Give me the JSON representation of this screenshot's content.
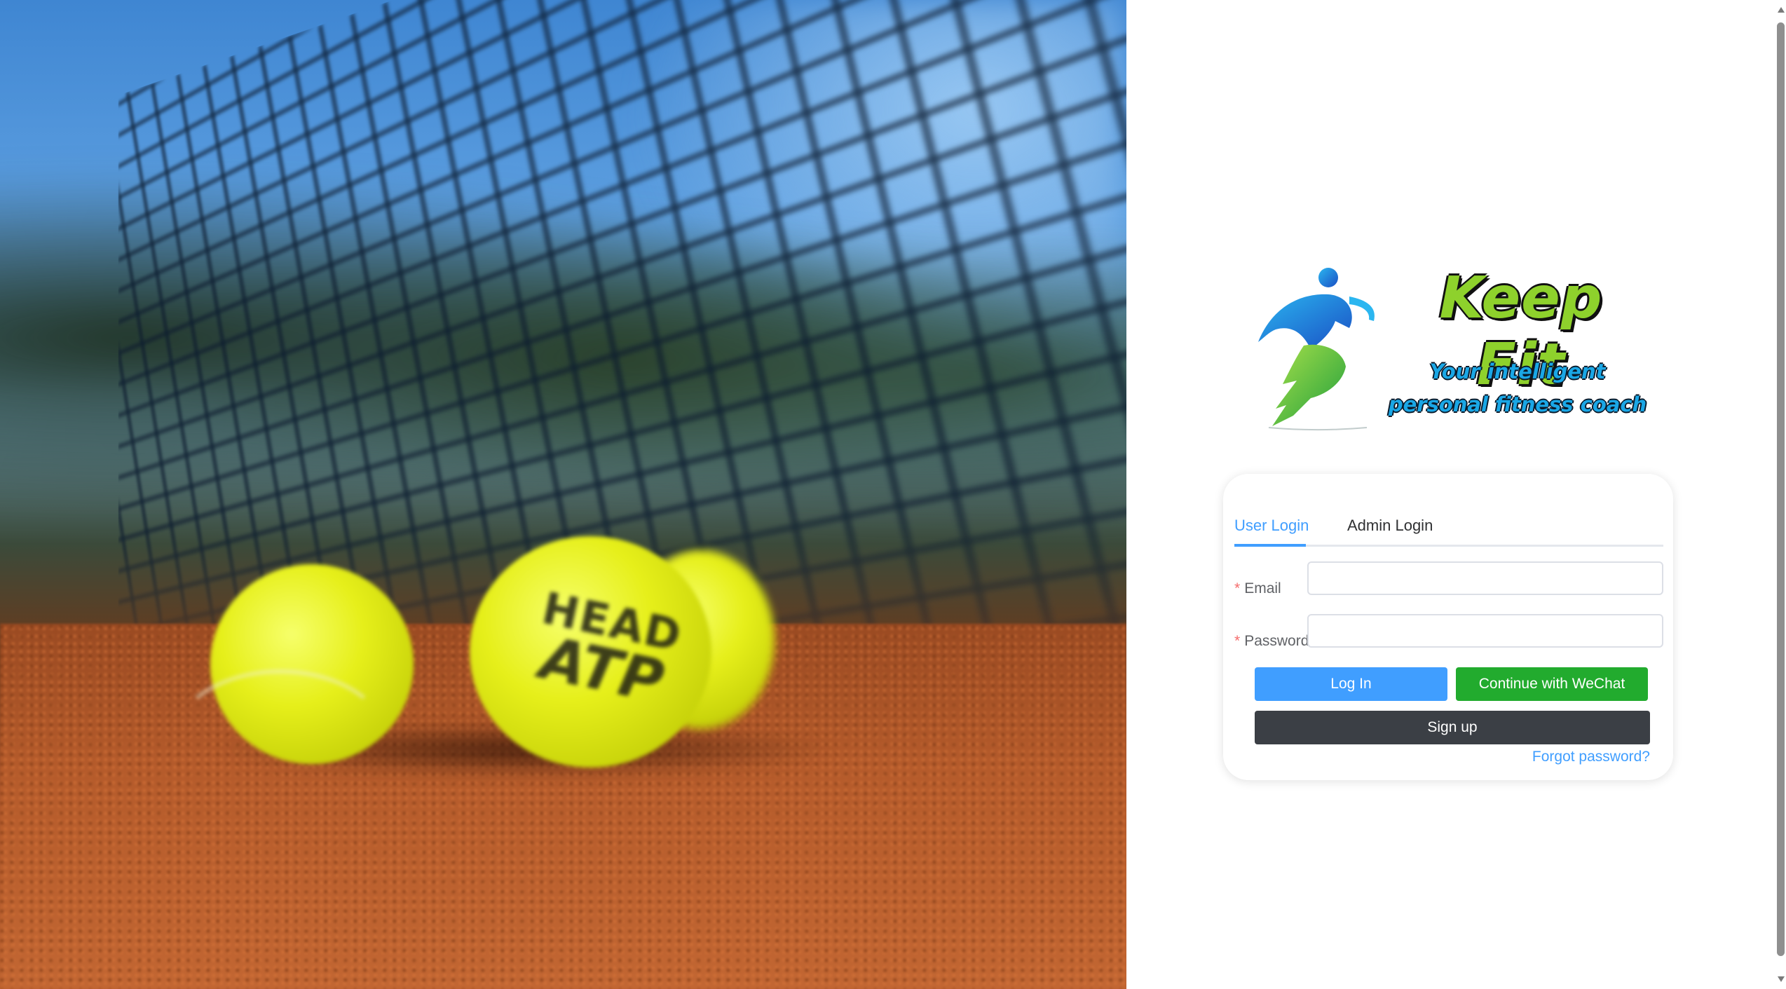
{
  "brand": {
    "title": "Keep Fit",
    "tagline_line1": "Your intelligent",
    "tagline_line2": "personal fitness coach",
    "logo_icon": "running-figure-icon",
    "colors": {
      "title": "#8ed12c",
      "tagline": "#1aa7e6"
    }
  },
  "hero": {
    "ball_text_line1": "HEAD",
    "ball_text_line2": "ATP"
  },
  "tabs": [
    {
      "label": "User Login",
      "active": true
    },
    {
      "label": "Admin Login",
      "active": false
    }
  ],
  "form": {
    "email": {
      "label": "Email",
      "value": "",
      "placeholder": ""
    },
    "password": {
      "label": "Password",
      "value": "",
      "placeholder": ""
    },
    "required_marker": "*"
  },
  "buttons": {
    "login": "Log In",
    "wechat": "Continue with WeChat",
    "signup": "Sign up",
    "forgot": "Forgot password?"
  },
  "colors": {
    "primary": "#409eff",
    "wechat": "#22ab2e",
    "signup": "#3b3f45",
    "required": "#f56c6c"
  }
}
